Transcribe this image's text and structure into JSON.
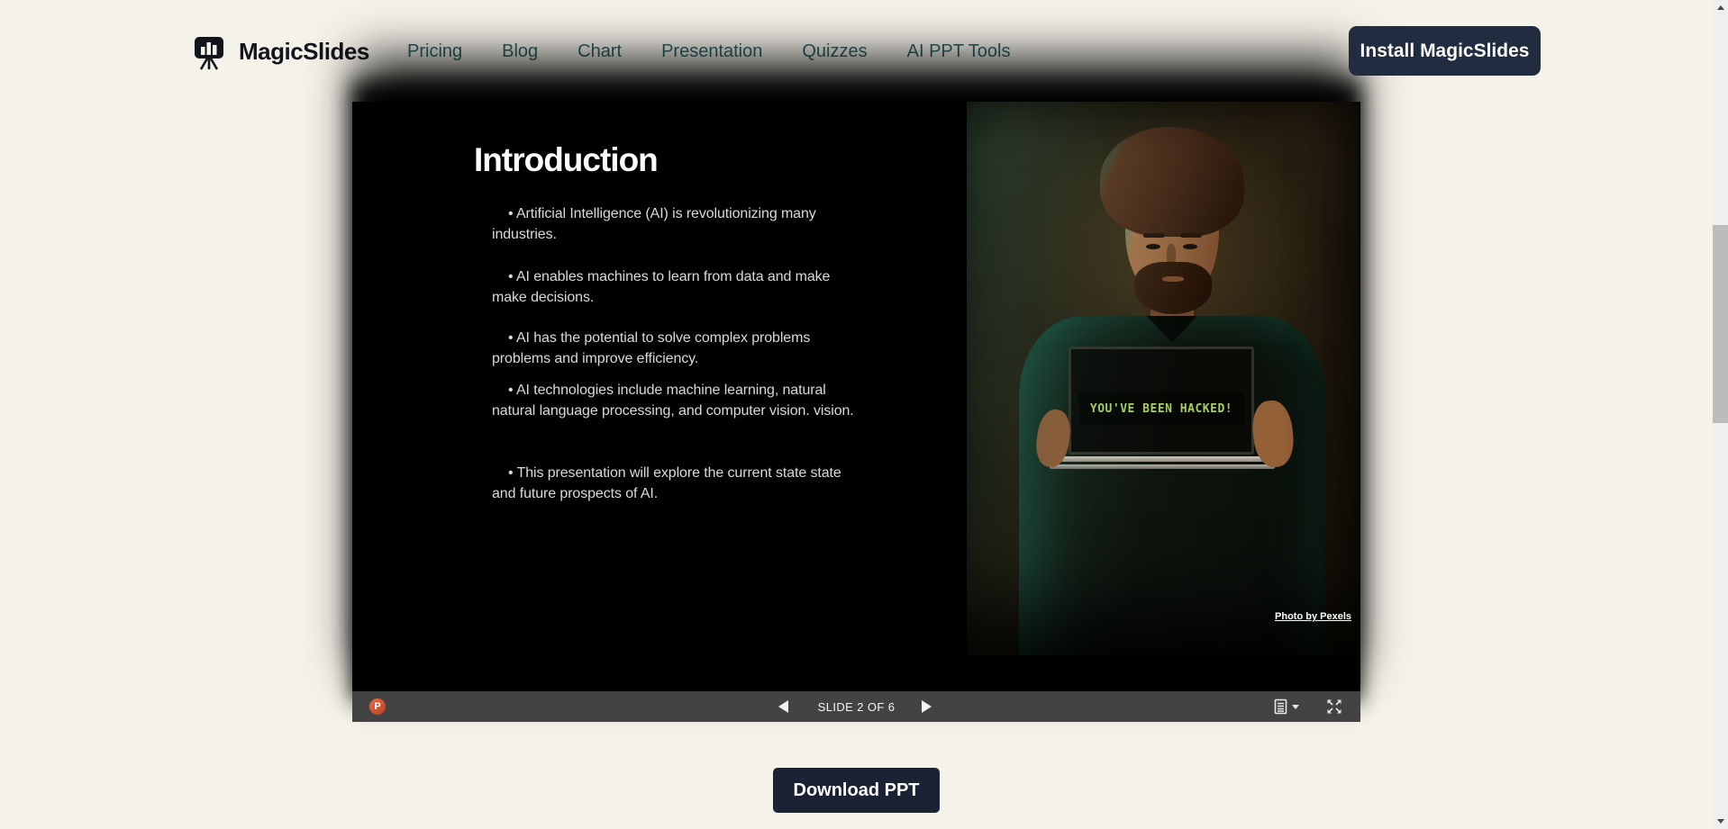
{
  "header": {
    "brand": "MagicSlides",
    "nav": [
      "Pricing",
      "Blog",
      "Chart",
      "Presentation",
      "Quizzes",
      "AI PPT Tools"
    ],
    "install_button": "Install MagicSlides"
  },
  "slide": {
    "title": "Introduction",
    "bullets": [
      "Artificial Intelligence (AI) is revolutionizing many industries.",
      "AI enables machines to learn from data and make make decisions.",
      "AI has the potential to solve complex problems problems and improve efficiency.",
      "AI technologies include machine learning, natural natural language processing, and computer vision. vision.",
      "This presentation will explore the current state state and future prospects of AI."
    ],
    "photo": {
      "hacked_text": "YOU'VE BEEN HACKED!",
      "credit": "Photo by Pexels"
    }
  },
  "player": {
    "ppt_letter": "P",
    "slide_status": "SLIDE 2 OF 6",
    "icons": {
      "prev": "left-arrow-icon",
      "next": "right-arrow-icon",
      "menu": "slide-list-icon",
      "fullscreen": "expand-icon",
      "file_type": "powerpoint-icon"
    }
  },
  "footer": {
    "download_button": "Download PPT"
  },
  "colors": {
    "page_bg": "#f5f2e9",
    "nav_link": "#2d6468",
    "install_btn_bg": "#212c40",
    "download_btn_bg": "#1a2233",
    "slide_bg": "#000000",
    "control_bar_bg": "#434343",
    "hacked_green": "#a8cf5e",
    "ppt_orange": "#d35230"
  }
}
